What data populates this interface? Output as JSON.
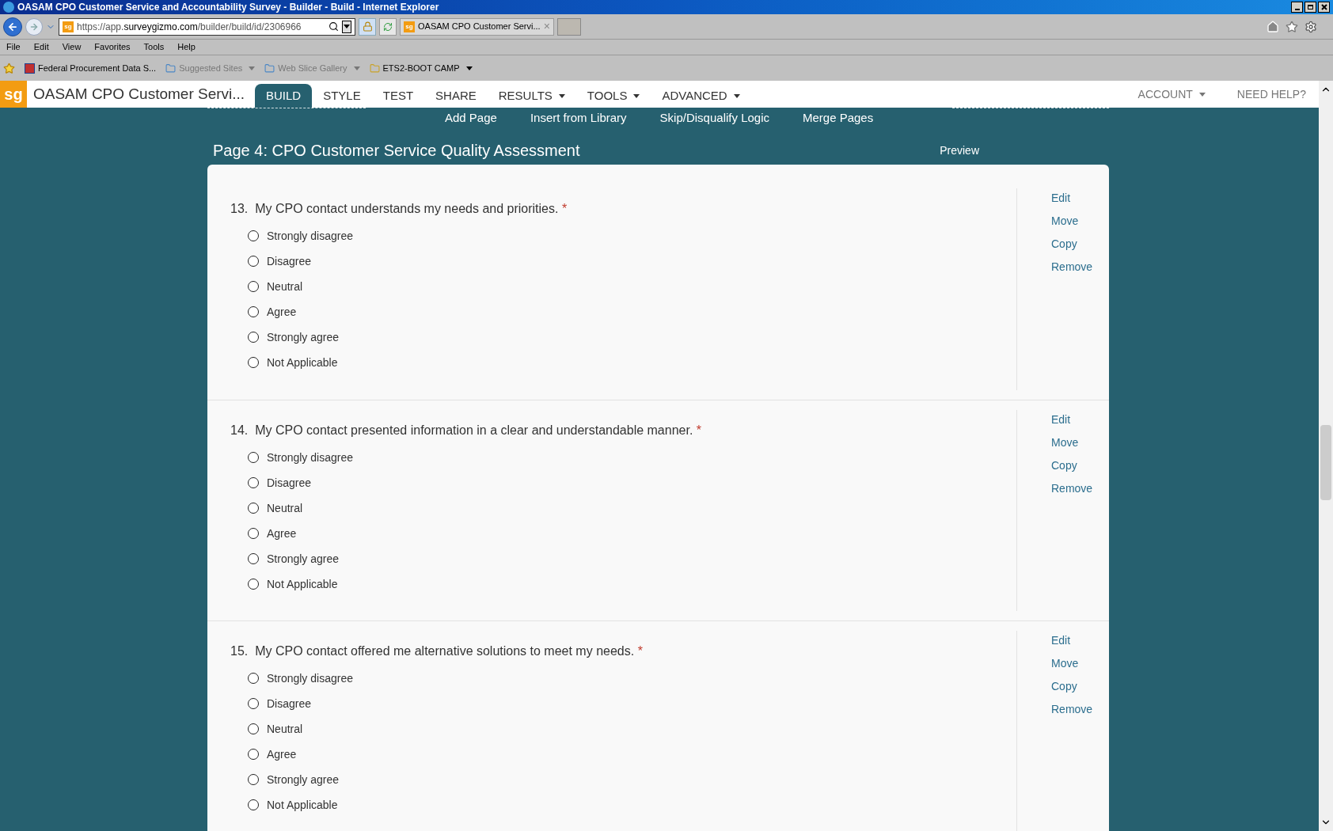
{
  "window": {
    "title": "OASAM CPO Customer Service and Accountability Survey - Builder - Build - Internet Explorer"
  },
  "address_bar": {
    "site_logo": "sg",
    "url_prefix": "https://app.",
    "url_domain": "surveygizmo.com",
    "url_path": "/builder/build/id/2306966"
  },
  "browser_tab": {
    "site_logo": "sg",
    "label": "OASAM CPO Customer Servi...",
    "close": "×"
  },
  "menu_bar": [
    "File",
    "Edit",
    "View",
    "Favorites",
    "Tools",
    "Help"
  ],
  "favorites_bar": [
    {
      "label": "Federal Procurement Data S...",
      "kind": "link",
      "dimmed": false
    },
    {
      "label": "Suggested Sites",
      "kind": "dropdown",
      "dimmed": true
    },
    {
      "label": "Web Slice Gallery",
      "kind": "dropdown",
      "dimmed": true
    },
    {
      "label": "ETS2-BOOT CAMP",
      "kind": "dropdown",
      "dimmed": false
    }
  ],
  "app_nav": {
    "logo": "sg",
    "survey_title": "OASAM CPO Customer Servi...",
    "tabs": [
      {
        "label": "BUILD",
        "selected": true,
        "dropdown": false
      },
      {
        "label": "STYLE",
        "selected": false,
        "dropdown": false
      },
      {
        "label": "TEST",
        "selected": false,
        "dropdown": false
      },
      {
        "label": "SHARE",
        "selected": false,
        "dropdown": false
      },
      {
        "label": "RESULTS",
        "selected": false,
        "dropdown": true
      },
      {
        "label": "TOOLS",
        "selected": false,
        "dropdown": true
      },
      {
        "label": "ADVANCED",
        "selected": false,
        "dropdown": true
      }
    ],
    "right": [
      {
        "label": "ACCOUNT",
        "dropdown": true
      },
      {
        "label": "NEED HELP?",
        "dropdown": false
      }
    ]
  },
  "sub_nav": [
    "Add Page",
    "Insert from Library",
    "Skip/Disqualify Logic",
    "Merge Pages"
  ],
  "page": {
    "title": "Page 4: CPO Customer Service Quality Assessment",
    "preview": "Preview"
  },
  "questions": [
    {
      "number": "13.",
      "text": "My CPO contact understands my needs and priorities.",
      "required_mark": "*",
      "actions": [
        "Edit",
        "Move",
        "Copy",
        "Remove"
      ],
      "options": [
        {
          "label": "Strongly disagree",
          "selected": false
        },
        {
          "label": "Disagree",
          "selected": false
        },
        {
          "label": "Neutral",
          "selected": false
        },
        {
          "label": "Agree",
          "selected": false
        },
        {
          "label": "Strongly agree",
          "selected": false
        },
        {
          "label": "Not Applicable",
          "selected": false
        }
      ]
    },
    {
      "number": "14.",
      "text": "My CPO contact presented information in a clear and understandable manner.",
      "required_mark": "*",
      "actions": [
        "Edit",
        "Move",
        "Copy",
        "Remove"
      ],
      "options": [
        {
          "label": "Strongly disagree",
          "selected": false
        },
        {
          "label": "Disagree",
          "selected": false
        },
        {
          "label": "Neutral",
          "selected": false
        },
        {
          "label": "Agree",
          "selected": false
        },
        {
          "label": "Strongly agree",
          "selected": false
        },
        {
          "label": "Not Applicable",
          "selected": false
        }
      ]
    },
    {
      "number": "15.",
      "text": "My CPO contact offered me alternative solutions to meet my needs.",
      "required_mark": "*",
      "actions": [
        "Edit",
        "Move",
        "Copy",
        "Remove"
      ],
      "options": [
        {
          "label": "Strongly disagree",
          "selected": false
        },
        {
          "label": "Disagree",
          "selected": false
        },
        {
          "label": "Neutral",
          "selected": false
        },
        {
          "label": "Agree",
          "selected": false
        },
        {
          "label": "Strongly agree",
          "selected": false
        },
        {
          "label": "Not Applicable",
          "selected": false
        }
      ]
    }
  ]
}
